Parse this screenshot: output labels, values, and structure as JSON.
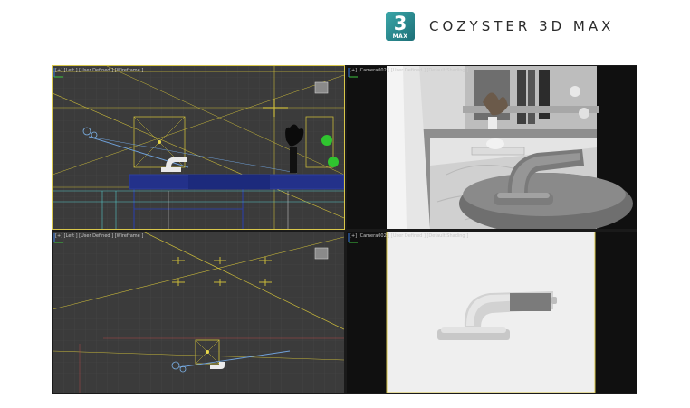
{
  "brand": {
    "logo_number": "3",
    "logo_sub": "MAX",
    "title": "COZYSTER  3D MAX"
  },
  "viewports": {
    "top_left": {
      "label": "[+] [Left ] [User Defined ] [Wireframe ]"
    },
    "top_right": {
      "label": "[+] [Camera002 ] [User Defined ] [Default Shading ]"
    },
    "bottom_left": {
      "label": "[+] [Left ] [User Defined ] [Wireframe ]"
    },
    "bottom_right": {
      "label": "[+] [Camera002 ] [User Defined ] [Default Shading ]"
    }
  },
  "colors": {
    "wire_yellow": "#c9b93a",
    "wire_blue": "#2d3f9e",
    "wire_cyan": "#57c8c8",
    "grid_bg": "#3b3b3b",
    "accent_teal": "#2a8a8f"
  }
}
